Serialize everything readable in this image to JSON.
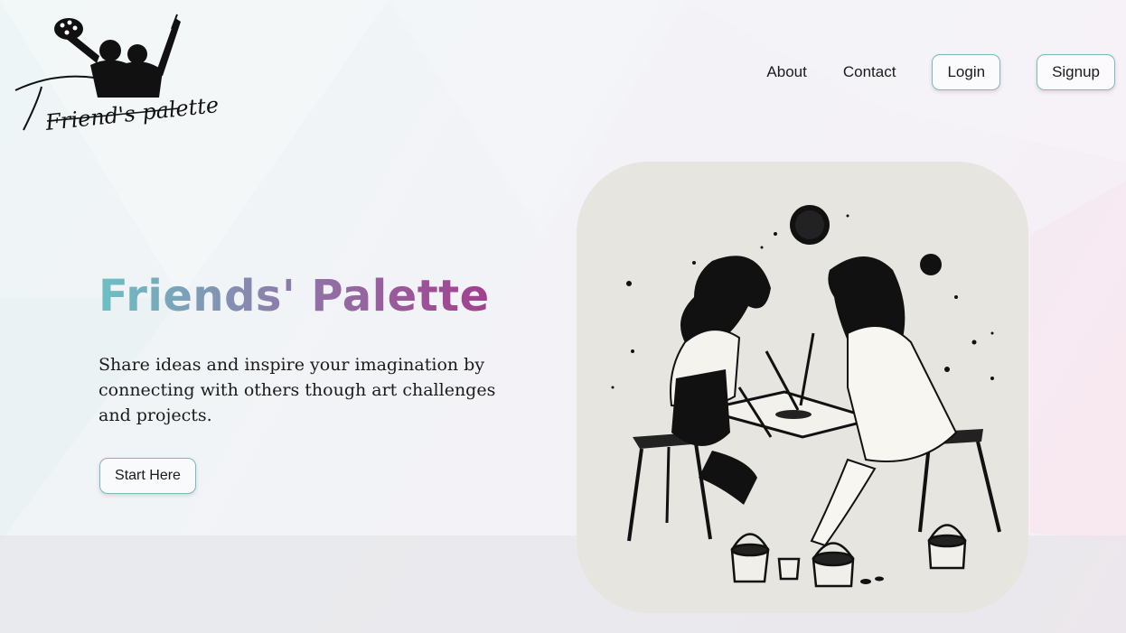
{
  "brand": {
    "logo_text": "Friend's palette"
  },
  "nav": {
    "about": "About",
    "contact": "Contact",
    "login": "Login",
    "signup": "Signup"
  },
  "hero": {
    "title": "Friends' Palette",
    "subtitle": "Share ideas and inspire your imagination by connecting with others though art challenges and projects.",
    "cta": "Start Here"
  },
  "colors": {
    "title_gradient_start": "#6cc1c4",
    "title_gradient_end": "#a23f8f",
    "button_border": "#7fb7bf",
    "text": "#1b1b1b"
  },
  "icons": {
    "logo": "two-friends-silhouette-with-palette-logo",
    "artwork": "two-girls-painting-illustration"
  }
}
